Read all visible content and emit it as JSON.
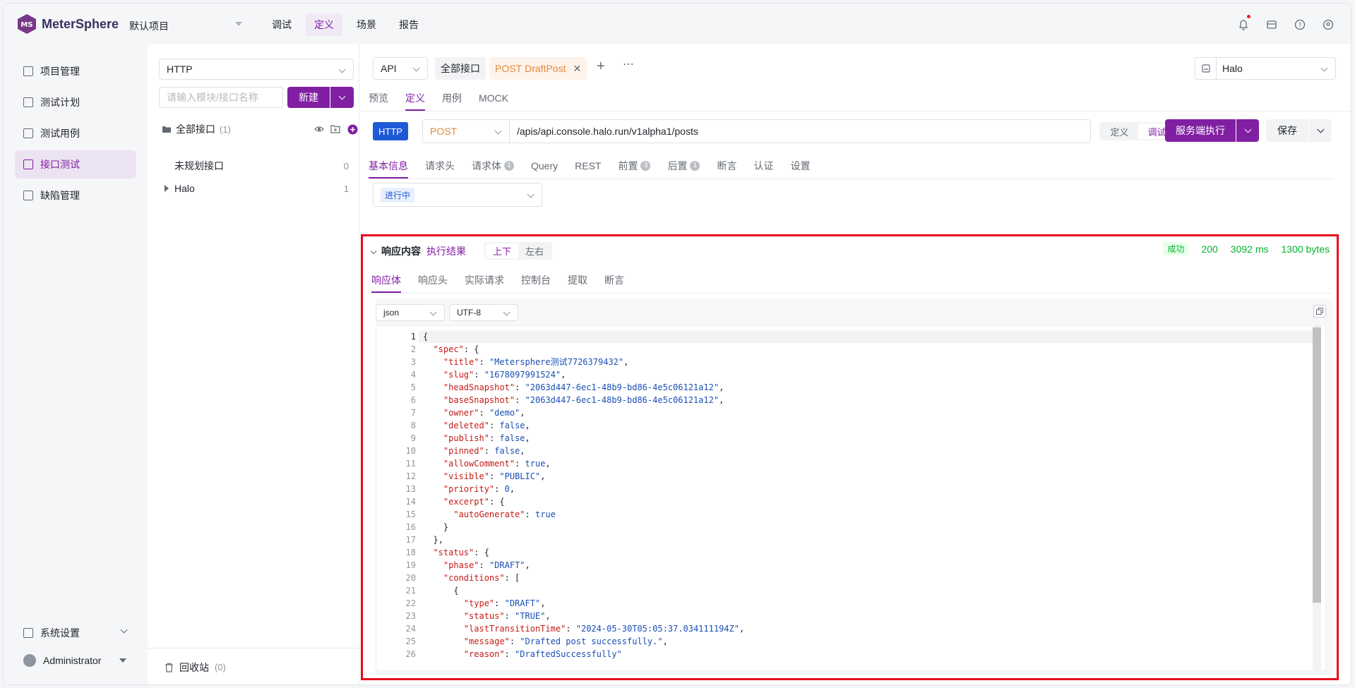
{
  "app": {
    "name": "MeterSphere",
    "project": "默认项目"
  },
  "topnav": [
    {
      "label": "调试",
      "active": false
    },
    {
      "label": "定义",
      "active": true
    },
    {
      "label": "场景",
      "active": false
    },
    {
      "label": "报告",
      "active": false
    }
  ],
  "sidebar": {
    "items": [
      {
        "label": "项目管理",
        "active": false
      },
      {
        "label": "测试计划",
        "active": false
      },
      {
        "label": "测试用例",
        "active": false
      },
      {
        "label": "接口测试",
        "active": true
      },
      {
        "label": "缺陷管理",
        "active": false
      }
    ],
    "settings": "系统设置",
    "user": "Administrator"
  },
  "tree": {
    "protocol": "HTTP",
    "search_placeholder": "请输入模块/接口名称",
    "new_label": "新建",
    "all_label": "全部接口",
    "all_count": "(1)",
    "rows": [
      {
        "label": "未规划接口",
        "count": "0"
      },
      {
        "label": "Halo",
        "count": "1"
      }
    ],
    "recycle_label": "回收站",
    "recycle_count": "(0)"
  },
  "main": {
    "type_select": "API",
    "all_api_tab": "全部接口",
    "open_tab_method": "POST",
    "open_tab_name": "DraftPost",
    "env": "Halo",
    "view_tabs": [
      "预览",
      "定义",
      "用例",
      "MOCK"
    ],
    "active_view": "定义",
    "protocol_badge": "HTTP",
    "method": "POST",
    "url": "/apis/api.console.halo.run/v1alpha1/posts",
    "mode_define": "定义",
    "mode_debug": "调试",
    "execute_label": "服务端执行",
    "save_label": "保存",
    "request_tabs": [
      {
        "label": "基本信息",
        "badge": ""
      },
      {
        "label": "请求头",
        "badge": ""
      },
      {
        "label": "请求体",
        "badge": "1"
      },
      {
        "label": "Query",
        "badge": ""
      },
      {
        "label": "REST",
        "badge": ""
      },
      {
        "label": "前置",
        "badge": "3"
      },
      {
        "label": "后置",
        "badge": "1"
      },
      {
        "label": "断言",
        "badge": ""
      },
      {
        "label": "认证",
        "badge": ""
      },
      {
        "label": "设置",
        "badge": ""
      }
    ],
    "status_tag": "进行中"
  },
  "response": {
    "title": "响应内容",
    "result_label": "执行结果",
    "layout_vertical": "上下",
    "layout_horizontal": "左右",
    "status_badge": "成功",
    "status_code": "200",
    "time": "3092 ms",
    "size": "1300 bytes",
    "tabs": [
      "响应体",
      "响应头",
      "实际请求",
      "控制台",
      "提取",
      "断言"
    ],
    "format": "json",
    "encoding": "UTF-8",
    "lines": [
      {
        "n": "1",
        "text": "{"
      },
      {
        "n": "2",
        "text": "  \"spec\": {"
      },
      {
        "n": "3",
        "text": "    \"title\": \"Metersphere测试7726379432\","
      },
      {
        "n": "4",
        "text": "    \"slug\": \"1678097991524\","
      },
      {
        "n": "5",
        "text": "    \"headSnapshot\": \"2063d447-6ec1-48b9-bd86-4e5c06121a12\","
      },
      {
        "n": "6",
        "text": "    \"baseSnapshot\": \"2063d447-6ec1-48b9-bd86-4e5c06121a12\","
      },
      {
        "n": "7",
        "text": "    \"owner\": \"demo\","
      },
      {
        "n": "8",
        "text": "    \"deleted\": false,"
      },
      {
        "n": "9",
        "text": "    \"publish\": false,"
      },
      {
        "n": "10",
        "text": "    \"pinned\": false,"
      },
      {
        "n": "11",
        "text": "    \"allowComment\": true,"
      },
      {
        "n": "12",
        "text": "    \"visible\": \"PUBLIC\","
      },
      {
        "n": "13",
        "text": "    \"priority\": 0,"
      },
      {
        "n": "14",
        "text": "    \"excerpt\": {"
      },
      {
        "n": "15",
        "text": "      \"autoGenerate\": true"
      },
      {
        "n": "16",
        "text": "    }"
      },
      {
        "n": "17",
        "text": "  },"
      },
      {
        "n": "18",
        "text": "  \"status\": {"
      },
      {
        "n": "19",
        "text": "    \"phase\": \"DRAFT\","
      },
      {
        "n": "20",
        "text": "    \"conditions\": ["
      },
      {
        "n": "21",
        "text": "      {"
      },
      {
        "n": "22",
        "text": "        \"type\": \"DRAFT\","
      },
      {
        "n": "23",
        "text": "        \"status\": \"TRUE\","
      },
      {
        "n": "24",
        "text": "        \"lastTransitionTime\": \"2024-05-30T05:05:37.034111194Z\","
      },
      {
        "n": "25",
        "text": "        \"message\": \"Drafted post successfully.\","
      },
      {
        "n": "26",
        "text": "        \"reason\": \"DraftedSuccessfully\""
      }
    ]
  },
  "colors": {
    "brand": "#811fa3",
    "success": "#00b42a",
    "highlight_border": "#e8081c"
  }
}
